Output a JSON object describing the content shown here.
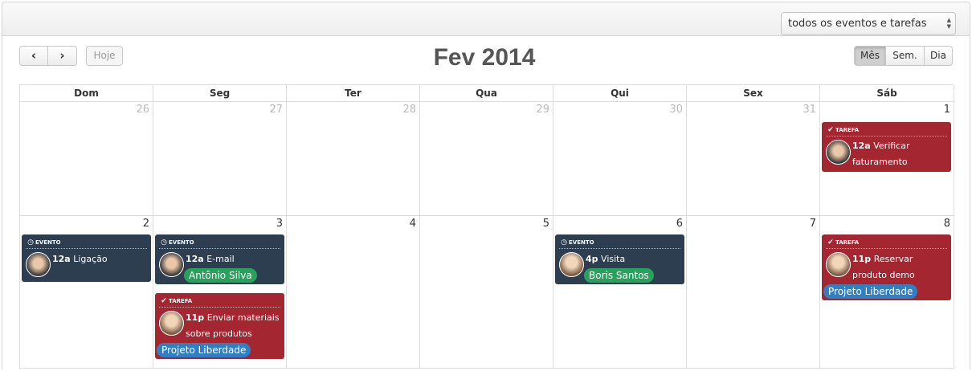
{
  "filter": {
    "selected": "todos os eventos e tarefas",
    "arrows": "▲▼"
  },
  "nav": {
    "prev_label": "‹",
    "next_label": "›",
    "today_label": "Hoje"
  },
  "title": "Fev 2014",
  "views": {
    "month": "Mês",
    "week": "Sem.",
    "day": "Dia"
  },
  "weekdays": [
    "Dom",
    "Seg",
    "Ter",
    "Qua",
    "Qui",
    "Sex",
    "Sáb"
  ],
  "weeks": [
    [
      "26",
      "27",
      "28",
      "29",
      "30",
      "31",
      "1"
    ],
    [
      "2",
      "3",
      "4",
      "5",
      "6",
      "7",
      "8"
    ]
  ],
  "events": [
    {
      "type": "TAREFA",
      "time": "12a",
      "title": "Verificar faturamento",
      "tag": ""
    },
    {
      "type": "EVENTO",
      "time": "12a",
      "title": "Ligação",
      "tag": ""
    },
    {
      "type": "EVENTO",
      "time": "12a",
      "title": "E-mail",
      "tag": "Antônio Silva"
    },
    {
      "type": "TAREFA",
      "time": "11p",
      "title": "Enviar materiais sobre produtos",
      "tag": "Projeto Liberdade"
    },
    {
      "type": "EVENTO",
      "time": "4p",
      "title": "Visita",
      "tag": "Boris Santos"
    },
    {
      "type": "TAREFA",
      "time": "11p",
      "title": "Reservar produto demo",
      "tag": "Projeto Liberdade"
    }
  ],
  "colors": {
    "event_dark": "#2c3e50",
    "task_red": "#a32631",
    "tag_green": "#27a25a",
    "tag_blue": "#2f7fc1"
  },
  "icons": {
    "event": "clock-icon",
    "task": "check-icon"
  }
}
